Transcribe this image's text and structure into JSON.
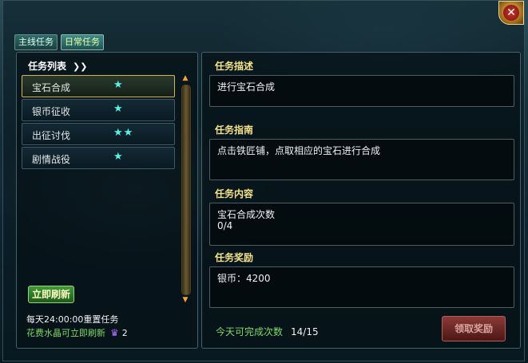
{
  "tabs": [
    "主线任务",
    "日常任务"
  ],
  "quest_list": {
    "title": "任务列表",
    "items": [
      {
        "name": "宝石合成",
        "stars": "★"
      },
      {
        "name": "银币征收",
        "stars": "★"
      },
      {
        "name": "出征讨伐",
        "stars": "★★"
      },
      {
        "name": "剧情战役",
        "stars": "★"
      }
    ],
    "refresh_label": "立即刷新",
    "reset_text": "每天24:00:00重置任务",
    "crystal_text": "花费水晶可立即刷新",
    "crystal_count": "2"
  },
  "details": {
    "desc_title": "任务描述",
    "desc": "进行宝石合成",
    "guide_title": "任务指南",
    "guide": "点击铁匠铺，点取相应的宝石进行合成",
    "content_title": "任务内容",
    "content_line1": "宝石合成次数",
    "content_line2": "0/4",
    "reward_title": "任务奖励",
    "reward": "银币：4200",
    "completion_label": "今天可完成次数",
    "completion_count": "14/15",
    "claim_label": "领取奖励"
  },
  "colors": {
    "accent_title": "#f4e38c",
    "star": "#5cf0e6",
    "green_text": "#7fd96a",
    "selected_border": "#d5b54b"
  }
}
